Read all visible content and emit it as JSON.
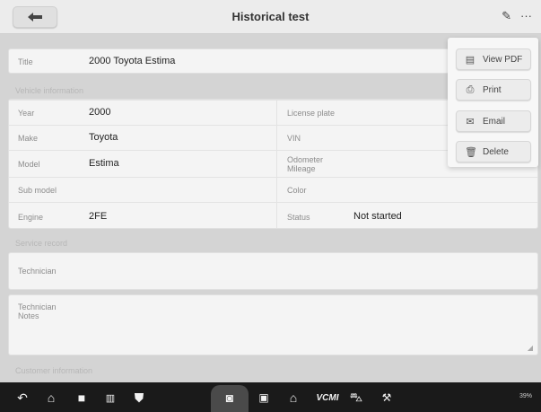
{
  "header": {
    "title": "Historical test"
  },
  "title_card": {
    "label": "Title",
    "value": "2000 Toyota Estima"
  },
  "vehicle_section": {
    "label": "Vehicle information",
    "rows": [
      {
        "left_label": "Year",
        "left_value": "2000",
        "right_label": "License plate",
        "right_value": ""
      },
      {
        "left_label": "Make",
        "left_value": "Toyota",
        "right_label": "VIN",
        "right_value": ""
      },
      {
        "left_label": "Model",
        "left_value": "Estima",
        "right_label": "Odometer Mileage",
        "right_value": ""
      },
      {
        "left_label": "Sub model",
        "left_value": "",
        "right_label": "Color",
        "right_value": ""
      },
      {
        "left_label": "Engine",
        "left_value": "2FE",
        "right_label": "Status",
        "right_value": "Not started"
      }
    ]
  },
  "service_section": {
    "label": "Service record",
    "technician_label": "Technician",
    "notes_label": "Technician Notes"
  },
  "customer_section": {
    "label": "Customer information"
  },
  "menu": {
    "items": [
      {
        "label": "View PDF",
        "icon": "pdf-icon"
      },
      {
        "label": "Print",
        "icon": "print-icon"
      },
      {
        "label": "Email",
        "icon": "email-icon"
      },
      {
        "label": "Delete",
        "icon": "trash-icon"
      }
    ]
  },
  "taskbar": {
    "vcmi_label": "VCMI",
    "status_text": "39%"
  }
}
